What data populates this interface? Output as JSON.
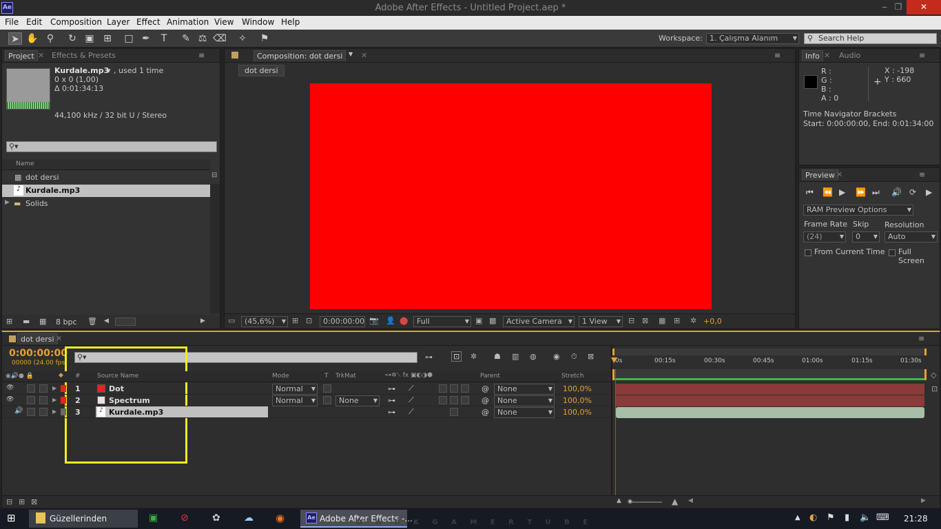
{
  "window": {
    "title": "Adobe After Effects - Untitled Project.aep *",
    "logo": "Ae",
    "minimize": "‒",
    "restore": "❐",
    "close": "✕"
  },
  "menu": [
    "File",
    "Edit",
    "Composition",
    "Layer",
    "Effect",
    "Animation",
    "View",
    "Window",
    "Help"
  ],
  "toolbar": {
    "workspace_label": "Workspace:",
    "workspace_value": "1. Çalışma Alanım",
    "search_placeholder": "Search Help"
  },
  "project": {
    "tab_project": "Project",
    "tab_effects": "Effects & Presets",
    "item_name": "Kurdale.mp3",
    "item_used": ", used 1 time",
    "item_dims": "0 x 0 (1,00)",
    "item_duration": "Δ 0:01:34:13",
    "item_audio": "44,100 kHz / 32 bit U / Stereo",
    "col_name": "Name",
    "items": [
      "dot dersi",
      "Kurdale.mp3",
      "Solids"
    ],
    "bpc": "8 bpc"
  },
  "composition": {
    "tab": "Composition: dot dersi",
    "subtab": "dot dersi",
    "zoom": "(45,6%)",
    "timecode": "0:00:00:00",
    "resolution": "Full",
    "camera": "Active Camera",
    "view": "1 View",
    "exposure": "+0,0",
    "bg_color": "#ff0000"
  },
  "info": {
    "tab_info": "Info",
    "tab_audio": "Audio",
    "r": "R :",
    "g": "G :",
    "b": "B :",
    "a": "A : 0",
    "x": "X : -198",
    "y": "Y : 660",
    "nav_title": "Time Navigator Brackets",
    "nav_range": "Start: 0:00:00:00, End: 0:01:34:00"
  },
  "preview": {
    "tab": "Preview",
    "ram": "RAM Preview Options",
    "frame_rate_label": "Frame Rate",
    "skip_label": "Skip",
    "resolution_label": "Resolution",
    "frame_rate": "(24)",
    "skip": "0",
    "resolution": "Auto",
    "from_current": "From Current Time",
    "full_screen": "Full Screen"
  },
  "timeline": {
    "tab": "dot dersi",
    "timecode": "0:00:00:00",
    "fps": "00000 (24.00 fps)",
    "col_num": "#",
    "col_source": "Source Name",
    "col_mode": "Mode",
    "col_t": "T",
    "col_trkmat": "TrkMat",
    "col_parent": "Parent",
    "col_stretch": "Stretch",
    "ruler": [
      "0s",
      "00:15s",
      "00:30s",
      "00:45s",
      "01:00s",
      "01:15s",
      "01:30s"
    ],
    "layers": [
      {
        "num": "1",
        "name": "Dot",
        "color": "#e8231b",
        "mode": "Normal",
        "trkmat": "",
        "parent": "None",
        "stretch": "100,0%"
      },
      {
        "num": "2",
        "name": "Spectrum",
        "color": "#f0e0e0",
        "mode": "Normal",
        "trkmat": "None",
        "parent": "None",
        "stretch": "100,0%"
      },
      {
        "num": "3",
        "name": "Kurdale.mp3",
        "color": "",
        "mode": "",
        "trkmat": "",
        "parent": "None",
        "stretch": "100,0%"
      }
    ]
  },
  "taskbar": {
    "folder": "Güzellerinden",
    "ae": "Adobe After Effects -...",
    "clock": "21:28",
    "watermark": "D A R K G A M E R T U B E"
  }
}
